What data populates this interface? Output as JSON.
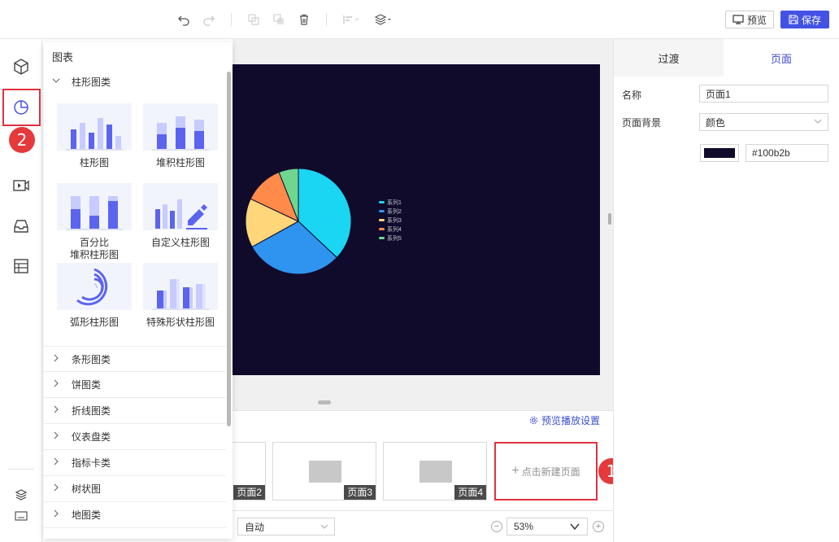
{
  "toolbar": {
    "preview_label": "预览",
    "save_label": "保存",
    "icons": [
      "undo-icon",
      "redo-icon",
      "copy-icon",
      "paste-icon",
      "delete-icon",
      "align-icon",
      "layer-icon"
    ]
  },
  "rail": {
    "items": [
      "component-icon",
      "chart-icon",
      "media-icon",
      "video-icon",
      "inbox-icon",
      "table-icon"
    ],
    "bottom_items": [
      "layers-icon",
      "keyboard-icon"
    ],
    "badge": "2"
  },
  "flyout": {
    "title": "图表",
    "open_category": "柱形图类",
    "charts": [
      {
        "label": "柱形图"
      },
      {
        "label": "堆积柱形图"
      },
      {
        "label": "百分比\n堆积柱形图"
      },
      {
        "label": "自定义柱形图"
      },
      {
        "label": "弧形柱形图"
      },
      {
        "label": "特殊形状柱形图"
      }
    ],
    "categories": [
      "条形图类",
      "饼图类",
      "折线图类",
      "仪表盘类",
      "指标卡类",
      "树状图",
      "地图类"
    ]
  },
  "canvas": {
    "background": "#100b2b",
    "legend": [
      {
        "name": "系列1",
        "color": "#1bd6f2"
      },
      {
        "name": "系列2",
        "color": "#2f94f0"
      },
      {
        "name": "系列3",
        "color": "#ffd67a"
      },
      {
        "name": "系列4",
        "color": "#ff8a4a"
      },
      {
        "name": "系列5",
        "color": "#6fd68f"
      }
    ]
  },
  "chart_data": {
    "type": "pie",
    "categories": [
      "系列1",
      "系列2",
      "系列3",
      "系列4",
      "系列5"
    ],
    "values": [
      37,
      30,
      15,
      12,
      6
    ],
    "colors": [
      "#1bd6f2",
      "#2f94f0",
      "#ffd67a",
      "#ff8a4a",
      "#6fd68f"
    ],
    "legend_position": "right"
  },
  "pages": {
    "preview_setting": "预览播放设置",
    "items": [
      {
        "label": "页面2"
      },
      {
        "label": "页面3"
      },
      {
        "label": "页面4"
      }
    ],
    "new_page": "点击新建页面",
    "badge": "1"
  },
  "bottom": {
    "mode": "自动",
    "zoom": "53%"
  },
  "right": {
    "tabs": [
      "过渡",
      "页面"
    ],
    "active_tab": "页面",
    "name_label": "名称",
    "name_value": "页面1",
    "bg_label": "页面背景",
    "bg_type": "颜色",
    "bg_color": "#100b2b"
  }
}
